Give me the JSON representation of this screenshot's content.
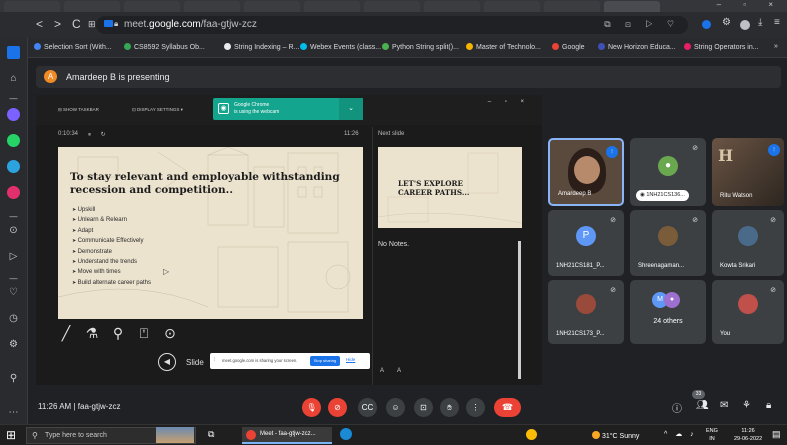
{
  "browser": {
    "back": "<",
    "forward": ">",
    "reload": "C",
    "apps": "⊞",
    "url_plain": "meet.",
    "url_domain": "google.com",
    "url_path": "/faa-gtjw-zcz"
  },
  "bookmarks": [
    {
      "label": "Selection Sort (With...",
      "color": "#4285f4"
    },
    {
      "label": "CS8592 Syllabus Ob...",
      "color": "#34a853"
    },
    {
      "label": "String Indexing – R...",
      "color": "#e8eaed"
    },
    {
      "label": "Webex Events (class...",
      "color": "#00bceb"
    },
    {
      "label": "Python String split()...",
      "color": "#4caf50"
    },
    {
      "label": "Master of Technolo...",
      "color": "#f4b400"
    },
    {
      "label": "Google",
      "color": "#ea4335"
    },
    {
      "label": "New Horizon Educa...",
      "color": "#3f51b5"
    },
    {
      "label": "String Operators in...",
      "color": "#e91e63"
    }
  ],
  "bookmarks_more": "»",
  "presenting": {
    "avatar_letter": "A",
    "text": "Amardeep B is presenting"
  },
  "ppt": {
    "show_taskbar": "SHOW TASKBAR",
    "display_settings": "DISPLAY SETTINGS ▾",
    "chrome_notice_title": "Google Chrome",
    "chrome_notice_body": "is using the webcam",
    "chrome_notice_more": "⌄",
    "window_buttons": "– ▫ ×",
    "timer": "0:10:34",
    "timer_icons": "⏸ ↻",
    "clock": "11:26",
    "next_slide_label": "Next slide",
    "notes": "No Notes.",
    "font_size_buttons": "A A"
  },
  "slide": {
    "title": "To stay relevant and employable withstanding recession and competition..",
    "bullets": [
      "Upskill",
      "Unlearn & Relearn",
      "Adapt",
      "Communicate Effectively",
      "Demonstrate",
      "Understand the trends",
      "Move with times",
      "Build alternate career paths"
    ],
    "cursor": "▷"
  },
  "next_slide": {
    "title": "LET'S EXPLORE CAREER PATHS..."
  },
  "tools": {
    "pen": "╱",
    "laser": "⚗",
    "zoom": "⚲",
    "subtitles": "⍞",
    "more": "⊙"
  },
  "slide_nav": {
    "prev": "◀",
    "label": "Slide"
  },
  "share_bar": {
    "text": "meet.google.com is sharing your screen.",
    "stop": "Stop sharing",
    "hide": "Hide"
  },
  "participants": [
    {
      "name": "Amardeep B",
      "type": "video"
    },
    {
      "name": "1NH21CS136...",
      "type": "avatar",
      "letter": "",
      "color": "#6aa84f"
    },
    {
      "name": "Ritu Watson",
      "type": "video"
    },
    {
      "name": "1NH21CS181_P...",
      "type": "avatar",
      "letter": "P",
      "color": "#5e97f6"
    },
    {
      "name": "Shreenagaman...",
      "type": "photo"
    },
    {
      "name": "Kowta Srikari",
      "type": "photo"
    },
    {
      "name": "1NH21CS173_P...",
      "type": "photo"
    },
    {
      "name": "24 others",
      "type": "group"
    },
    {
      "name": "You",
      "type": "photo"
    }
  ],
  "meetbar": {
    "time": "11:26 AM",
    "separator": "|",
    "code": "faa-gtjw-zcz",
    "people_count": "33"
  },
  "taskbar": {
    "search_placeholder": "Type here to search",
    "meet_task": "Meet - faa-gtjw-zcz...",
    "weather": "31°C  Sunny",
    "lang_1": "ENG",
    "lang_2": "IN",
    "time": "11:26",
    "date": "29-06-2022"
  }
}
